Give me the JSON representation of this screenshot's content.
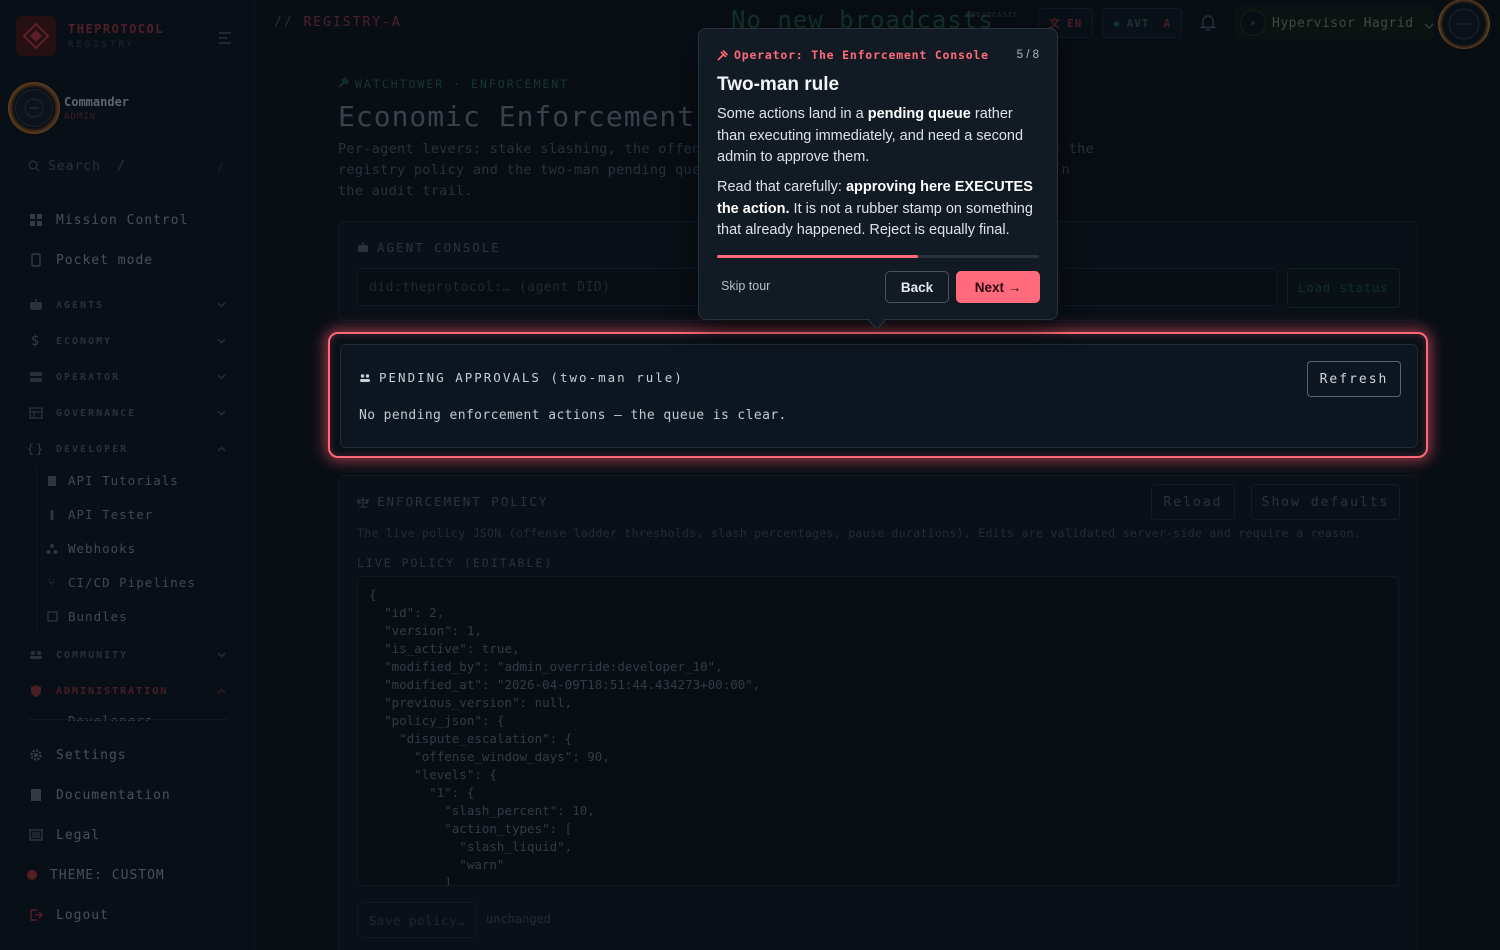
{
  "brand": {
    "name": "THEPROTOCOL",
    "sub": "REGISTRY"
  },
  "user": {
    "name": "Commander",
    "role": "ADMIN"
  },
  "sidebar": {
    "search_placeholder": "Search",
    "search_key": "/",
    "top_items": [
      {
        "label": "Mission Control",
        "icon": "grid-icon"
      },
      {
        "label": "Pocket mode",
        "icon": "phone-icon"
      }
    ],
    "groups": [
      {
        "label": "AGENTS",
        "icon": "robot-icon"
      },
      {
        "label": "ECONOMY",
        "icon": "dollar-icon"
      },
      {
        "label": "OPERATOR",
        "icon": "server-icon"
      },
      {
        "label": "GOVERNANCE",
        "icon": "table-icon"
      },
      {
        "label": "DEVELOPER",
        "icon": "braces-icon"
      }
    ],
    "developer_items": [
      {
        "label": "API Tutorials",
        "icon": "document-icon"
      },
      {
        "label": "API Tester",
        "icon": "flask-icon"
      },
      {
        "label": "Webhooks",
        "icon": "webhook-icon"
      },
      {
        "label": "CI/CD Pipelines",
        "icon": "branch-icon"
      },
      {
        "label": "Bundles",
        "icon": "package-icon"
      }
    ],
    "community_group": "COMMUNITY",
    "admin_group": "ADMINISTRATION",
    "admin_first_item": "Developers",
    "bottom_items": [
      {
        "label": "Settings",
        "icon": "gear-icon"
      },
      {
        "label": "Documentation",
        "icon": "book-icon"
      },
      {
        "label": "Legal",
        "icon": "list-icon"
      },
      {
        "label": "THEME: CUSTOM",
        "icon": "theme-dot-icon"
      },
      {
        "label": "Logout",
        "icon": "logout-icon"
      }
    ]
  },
  "topbar": {
    "crumb_prefix": "//",
    "crumb": "REGISTRY-A",
    "ticker": "No new broadcasts",
    "ticker_badge": "BROADCASTS",
    "lang": "EN",
    "currency": "AVT",
    "currency_suffix": "A",
    "user_name": "Hypervisor Hagrid"
  },
  "page": {
    "eyebrow": "WATCHTOWER · ENFORCEMENT",
    "title": "Economic Enforcement",
    "description_left": "Per-agent levers: stake slashing, the offense",
    "description_right": "s the",
    "description_line2_left": "registry policy and the two-man pending queue",
    "description_line2_right": "n",
    "description_line3": "the audit trail."
  },
  "agent_console": {
    "title": "AGENT CONSOLE",
    "did_placeholder": "did:theprotocol:… (agent DID)",
    "load_label": "Load status"
  },
  "pending": {
    "title": "PENDING APPROVALS (two-man rule)",
    "message": "No pending enforcement actions — the queue is clear.",
    "refresh_label": "Refresh"
  },
  "policy": {
    "title": "ENFORCEMENT POLICY",
    "reload_label": "Reload",
    "defaults_label": "Show defaults",
    "note": "The live policy JSON (offense ladder thresholds, slash percentages, pause durations). Edits are validated server-side and require a reason.",
    "live_label": "LIVE POLICY (EDITABLE)",
    "code_lines": [
      "{",
      "  \"id\": 2,",
      "  \"version\": 1,",
      "  \"is_active\": true,",
      "  \"modified_by\": \"admin_override:developer_10\",",
      "  \"modified_at\": \"2026-04-09T18:51:44.434273+00:00\",",
      "  \"previous_version\": null,",
      "  \"policy_json\": {",
      "    \"dispute_escalation\": {",
      "      \"offense_window_days\": 90,",
      "      \"levels\": {",
      "        \"1\": {",
      "          \"slash_percent\": 10,",
      "          \"action_types\": [",
      "            \"slash_liquid\",",
      "            \"warn\"",
      "          ]"
    ],
    "save_label": "Save policy…",
    "save_status": "unchanged"
  },
  "tour": {
    "header": "Operator: The Enforcement Console",
    "step": "5 / 8",
    "progress": 0.625,
    "title": "Two-man rule",
    "p1_a": "Some actions land in a ",
    "p1_b": "pending queue",
    "p1_c": " rather than executing immediately, and need a second admin to approve them.",
    "p2_a": "Read that carefully: ",
    "p2_b": "approving here EXECUTES the action.",
    "p2_c": " It is not a rubber stamp on something that already happened. Reject is equally final.",
    "skip_label": "Skip tour",
    "back_label": "Back",
    "next_label": "Next →"
  },
  "colors": {
    "accent": "#ff6b7c",
    "background": "#0b1119",
    "teal": "#164a3a"
  }
}
